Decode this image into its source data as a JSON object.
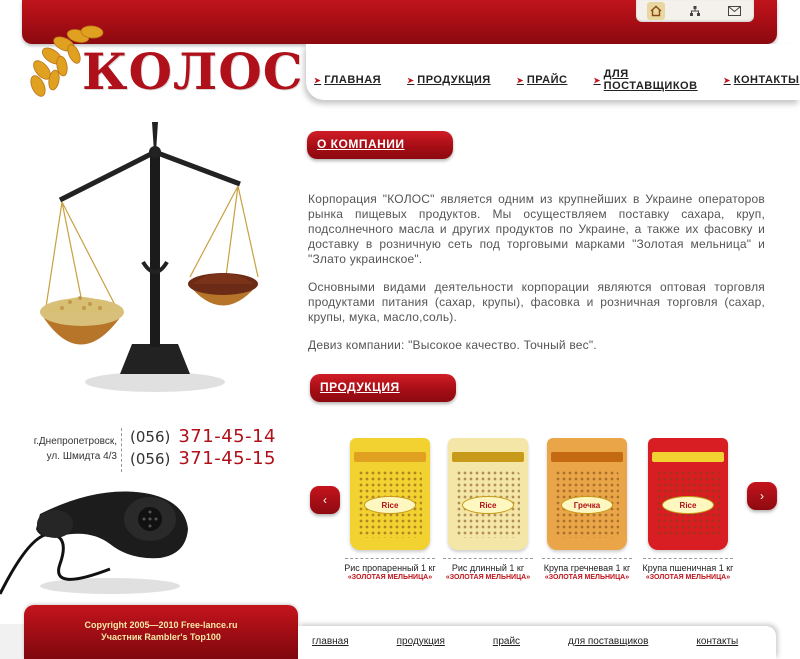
{
  "brand": {
    "logo_text": "КОЛОС"
  },
  "top_icons": [
    "home-icon",
    "sitemap-icon",
    "mail-icon"
  ],
  "nav": {
    "items": [
      {
        "label": "ГЛАВНАЯ"
      },
      {
        "label": "ПРОДУКЦИЯ"
      },
      {
        "label": "ПРАЙС"
      },
      {
        "label": "ДЛЯ ПОСТАВЩИКОВ"
      },
      {
        "label": "КОНТАКТЫ"
      }
    ]
  },
  "about": {
    "header": "О КОМПАНИИ",
    "p1": "Корпорация \"КОЛОС\" является одним из крупнейших в Украине операторов рынка пищевых продуктов. Мы осуществляем поставку сахара, круп, подсолнечного масла и других продуктов по Украине, а также их фасовку и доставку в розничную сеть под торговыми марками \"Золотая мельница\" и \"Злато украинское\".",
    "p2": "Основными видами деятельности корпорации являются оптовая торговля продуктами питания (сахар, крупы), фасовка и розничная торговля (сахар, крупы, мука, масло,соль).",
    "p3": "Девиз компании: \"Высокое качество. Точный вес\"."
  },
  "products": {
    "header": "ПРОДУКЦИЯ",
    "prev_label": "‹",
    "next_label": "›",
    "items": [
      {
        "name": "Рис пропаренный 1 кг",
        "brand": "«ЗОЛОТАЯ МЕЛЬНИЦА»",
        "bag_color": "#f2d230",
        "band_color": "#e0a020"
      },
      {
        "name": "Рис длинный  1 кг",
        "brand": "«ЗОЛОТАЯ МЕЛЬНИЦА»",
        "bag_color": "#f3e6a6",
        "band_color": "#c79b19"
      },
      {
        "name": "Крупа гречневая 1 кг",
        "brand": "«ЗОЛОТАЯ МЕЛЬНИЦА»",
        "bag_color": "#e9a548",
        "band_color": "#c46a12"
      },
      {
        "name": "Крупа пшеничная 1 кг",
        "brand": "«ЗОЛОТАЯ МЕЛЬНИЦА»",
        "bag_color": "#d81e22",
        "band_color": "#f2d230"
      }
    ]
  },
  "contacts": {
    "address_line1": "г.Днепропетровск,",
    "address_line2": "ул. Шмидта 4/3",
    "phones": [
      {
        "code": "(056)",
        "number": "371-45-14"
      },
      {
        "code": "(056)",
        "number": "371-45-15"
      }
    ]
  },
  "footer": {
    "copyright": "Copyright 2005—2010 Free-lance.ru",
    "rambler": "Участник Rambler's Top100",
    "links": [
      "главная",
      "продукция",
      "прайс",
      "для поставщиков",
      "контакты"
    ]
  },
  "colors": {
    "brand_red": "#b0101a",
    "accent_gold": "#f7e9a9"
  }
}
